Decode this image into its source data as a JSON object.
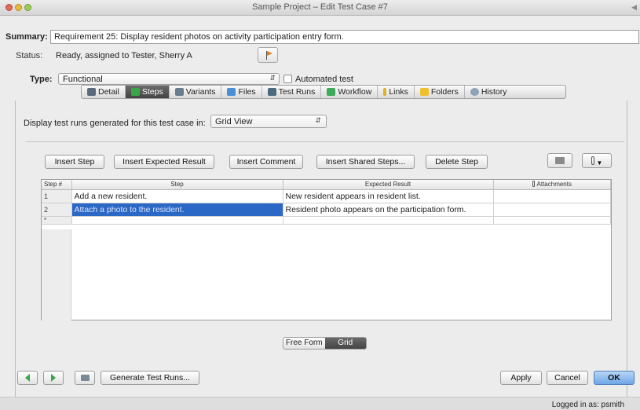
{
  "window": {
    "title": "Sample Project – Edit Test Case #7"
  },
  "summary": {
    "label": "Summary:",
    "value": "Requirement 25: Display resident photos on activity participation entry form."
  },
  "status": {
    "label": "Status:",
    "value": "Ready, assigned to Tester, Sherry A"
  },
  "type": {
    "label": "Type:",
    "value": "Functional",
    "automated_label": "Automated test",
    "automated_checked": false
  },
  "tabs": [
    {
      "label": "Detail",
      "icon": "detail-icon",
      "color": "#5a6b7c"
    },
    {
      "label": "Steps",
      "icon": "steps-icon",
      "color": "#3aa64a",
      "active": true
    },
    {
      "label": "Variants",
      "icon": "variants-icon",
      "color": "#6b7d8c"
    },
    {
      "label": "Files",
      "icon": "files-icon",
      "color": "#4a8fd6"
    },
    {
      "label": "Test Runs",
      "icon": "test-runs-icon",
      "color": "#4b6a7e"
    },
    {
      "label": "Workflow",
      "icon": "workflow-icon",
      "color": "#3cab5a"
    },
    {
      "label": "Links",
      "icon": "links-icon",
      "color": "#e0b12a"
    },
    {
      "label": "Folders",
      "icon": "folders-icon",
      "color": "#f0c02c"
    },
    {
      "label": "History",
      "icon": "history-icon",
      "color": "#8ea2b8"
    }
  ],
  "display": {
    "label": "Display test runs generated for this test case in:",
    "view_value": "Grid View"
  },
  "step_buttons": {
    "insert_step": "Insert Step",
    "insert_expected": "Insert Expected Result",
    "insert_comment": "Insert Comment",
    "insert_shared": "Insert Shared Steps...",
    "delete_step": "Delete Step"
  },
  "grid": {
    "headers": {
      "num": "Step #",
      "step": "Step",
      "expected": "Expected Result",
      "attachments": "Attachments"
    },
    "rows": [
      {
        "num": "1",
        "step": "Add a new resident.",
        "expected": "New resident appears in resident list."
      },
      {
        "num": "2",
        "step": "Attach a photo to the resident.",
        "expected": "Resident photo appears on the participation form."
      }
    ],
    "blank_marker": "*"
  },
  "mode": {
    "free_form": "Free Form",
    "grid": "Grid",
    "active": "grid"
  },
  "footer": {
    "generate": "Generate Test Runs...",
    "apply": "Apply",
    "cancel": "Cancel",
    "ok": "OK",
    "logged_in": "Logged in as: psmith"
  },
  "colors": {
    "selection": "#2b67c4",
    "ok_button": "#6ea7e7",
    "flag": "#e77c16",
    "nav_arrow": "#3aa64a"
  }
}
